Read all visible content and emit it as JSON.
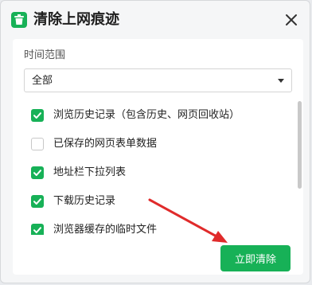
{
  "dialog": {
    "title": "清除上网痕迹",
    "app_icon": "trash-icon",
    "close_icon": "close-icon"
  },
  "time_range": {
    "label": "时间范围",
    "selected": "全部"
  },
  "items": [
    {
      "label": "浏览历史记录（包含历史、网页回收站）",
      "checked": true
    },
    {
      "label": "已保存的网页表单数据",
      "checked": false
    },
    {
      "label": "地址栏下拉列表",
      "checked": true
    },
    {
      "label": "下载历史记录",
      "checked": true
    },
    {
      "label": "浏览器缓存的临时文件",
      "checked": true
    }
  ],
  "actions": {
    "clear_now": "立即清除"
  },
  "colors": {
    "accent": "#17b157",
    "annotation_arrow": "#e02b2b"
  }
}
